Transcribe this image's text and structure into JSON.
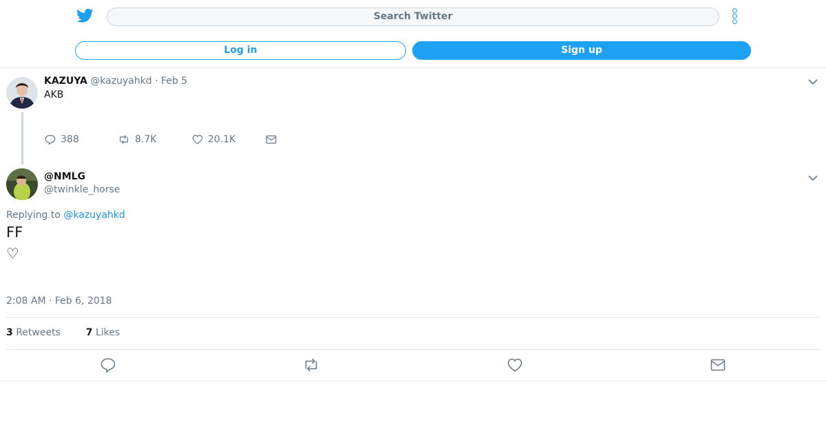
{
  "header": {
    "search_placeholder": "Search Twitter",
    "login_label": "Log in",
    "signup_label": "Sign up",
    "accent_color": "#1da1f2"
  },
  "parent_tweet": {
    "name": "KAZUYA",
    "handle": "@kazuyahkd",
    "date": "· Feb 5",
    "text": "AKB",
    "replies": "388",
    "retweets": "8.7K",
    "likes": "20.1K"
  },
  "main_tweet": {
    "name": "@NMLG",
    "handle": "@twinkle_horse",
    "replying_prefix": "Replying to",
    "replying_to": "@kazuyahkd",
    "text": "FF",
    "emoji": "♡",
    "timestamp": "2:08 AM · Feb 6, 2018",
    "retweet_count": "3",
    "retweet_label": "Retweets",
    "like_count": "7",
    "like_label": "Likes"
  },
  "icons": [
    "twitter-bird-icon",
    "more-icon",
    "chevron-down-icon",
    "reply-icon",
    "retweet-icon",
    "like-icon",
    "message-icon"
  ]
}
